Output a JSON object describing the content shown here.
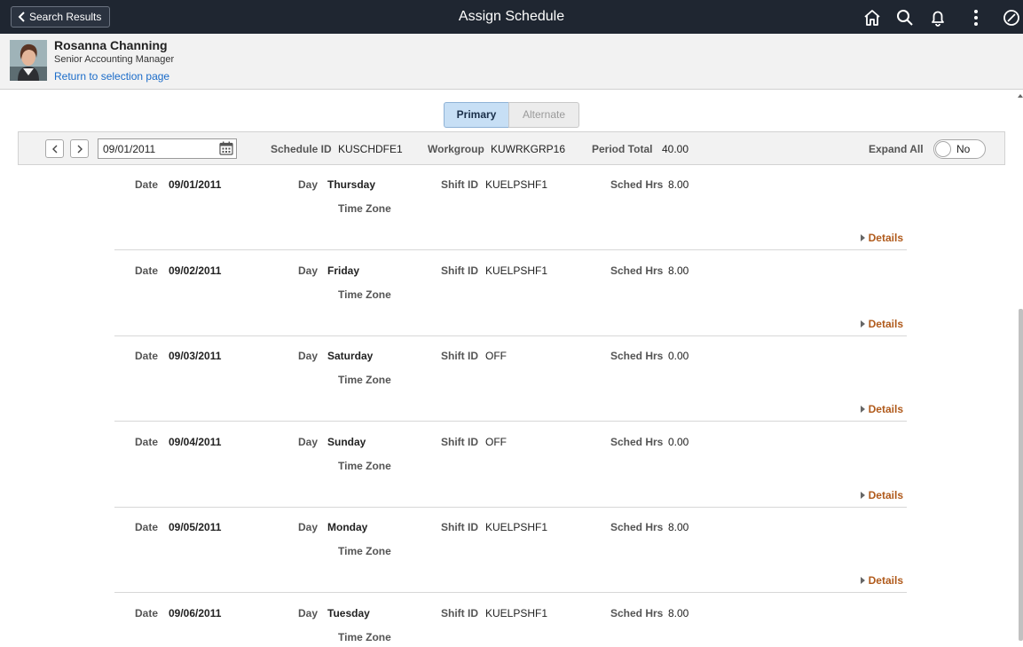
{
  "banner": {
    "back_label": "Search Results",
    "title": "Assign Schedule",
    "icons": [
      "home-icon",
      "search-icon",
      "bell-icon",
      "actions-menu-icon",
      "navbar-compass-icon"
    ]
  },
  "employee": {
    "name": "Rosanna Channing",
    "job_title": "Senior Accounting Manager",
    "return_link": "Return to selection page"
  },
  "segment": {
    "primary": "Primary",
    "alternate": "Alternate",
    "selected": "Primary"
  },
  "filter": {
    "date": "09/01/2011",
    "schedule_id_label": "Schedule ID",
    "schedule_id": "KUSCHDFE1",
    "workgroup_label": "Workgroup",
    "workgroup": "KUWRKGRP16",
    "period_total_label": "Period Total",
    "period_total": "40.00",
    "expand_all_label": "Expand All",
    "expand_all_value": "No"
  },
  "row_labels": {
    "date": "Date",
    "day": "Day",
    "shift_id": "Shift ID",
    "sched_hrs": "Sched Hrs",
    "time_zone": "Time Zone",
    "details": "Details"
  },
  "rows": [
    {
      "date": "09/01/2011",
      "day": "Thursday",
      "shift_id": "KUELPSHF1",
      "sched_hrs": "8.00"
    },
    {
      "date": "09/02/2011",
      "day": "Friday",
      "shift_id": "KUELPSHF1",
      "sched_hrs": "8.00"
    },
    {
      "date": "09/03/2011",
      "day": "Saturday",
      "shift_id": "OFF",
      "sched_hrs": "0.00"
    },
    {
      "date": "09/04/2011",
      "day": "Sunday",
      "shift_id": "OFF",
      "sched_hrs": "0.00"
    },
    {
      "date": "09/05/2011",
      "day": "Monday",
      "shift_id": "KUELPSHF1",
      "sched_hrs": "8.00"
    },
    {
      "date": "09/06/2011",
      "day": "Tuesday",
      "shift_id": "KUELPSHF1",
      "sched_hrs": "8.00"
    }
  ],
  "colors": {
    "banner_bg": "#1f2631",
    "link": "#1b6cc9",
    "details_link": "#b05a1b",
    "segment_selected": "#c7dff5"
  }
}
